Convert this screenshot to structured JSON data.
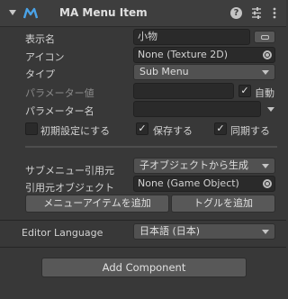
{
  "component": {
    "title": "MA Menu Item",
    "help_glyph": "?",
    "icons": [
      "foldout-arrow-icon",
      "ma-logo-icon",
      "help-icon",
      "preset-icon",
      "kebab-menu-icon"
    ]
  },
  "fields": {
    "display_name": {
      "label": "表示名",
      "value": "小物"
    },
    "icon": {
      "label": "アイコン",
      "value": "None (Texture 2D)"
    },
    "type": {
      "label": "タイプ",
      "value": "Sub Menu"
    },
    "parameter_value": {
      "label": "パラメーター値",
      "value": "",
      "auto_label": "自動",
      "auto_checked": true
    },
    "parameter_name": {
      "label": "パラメーター名",
      "value": ""
    }
  },
  "options": {
    "initial": {
      "label": "初期設定にする",
      "checked": false
    },
    "save": {
      "label": "保存する",
      "checked": true
    },
    "sync": {
      "label": "同期する",
      "checked": true
    }
  },
  "submenu": {
    "source_label": "サブメニュー引用元",
    "source_value": "子オブジェクトから生成",
    "object_label": "引用元オブジェクト",
    "object_value": "None (Game Object)",
    "add_item_button": "メニューアイテムを追加",
    "add_toggle_button": "トグルを追加"
  },
  "language": {
    "label": "Editor Language",
    "value": "日本語 (日本)"
  },
  "add_component": "Add Component",
  "check_glyph": "✓",
  "colors": {
    "background": "#383838",
    "header": "#3e3e3e",
    "field": "#2a2a2a",
    "button": "#585858",
    "accent_logo": "#4aa3e8"
  }
}
